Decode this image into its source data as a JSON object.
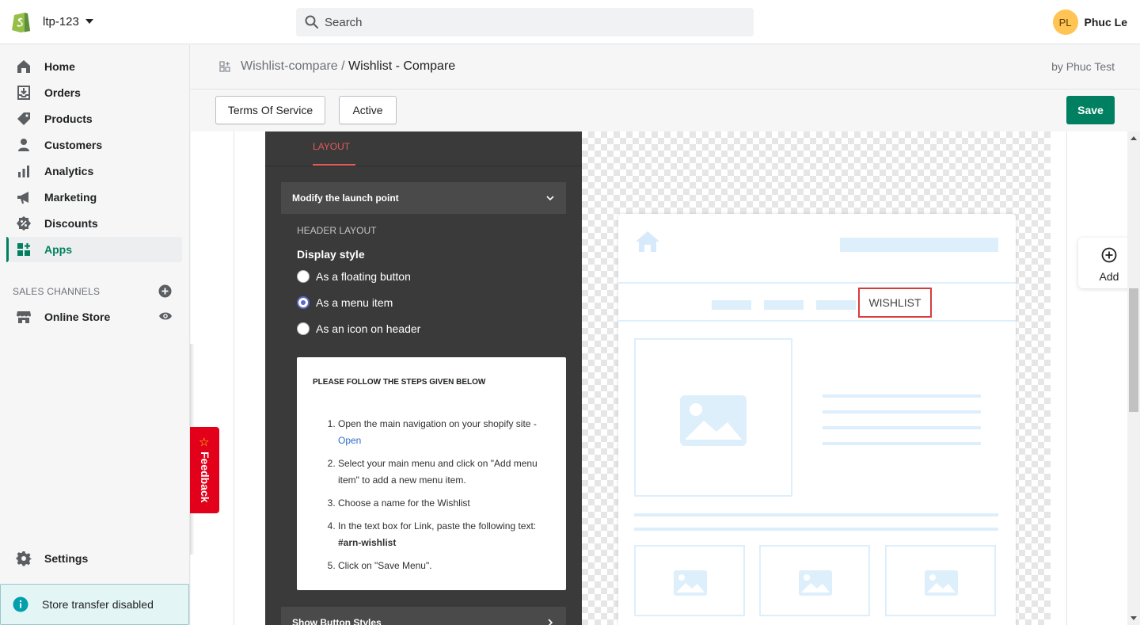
{
  "topbar": {
    "store_name": "ltp-123",
    "search_placeholder": "Search",
    "user_initials": "PL",
    "user_name": "Phuc Le"
  },
  "sidebar": {
    "items": [
      {
        "label": "Home",
        "icon": "home-icon"
      },
      {
        "label": "Orders",
        "icon": "orders-icon"
      },
      {
        "label": "Products",
        "icon": "tag-icon"
      },
      {
        "label": "Customers",
        "icon": "person-icon"
      },
      {
        "label": "Analytics",
        "icon": "bar-chart-icon"
      },
      {
        "label": "Marketing",
        "icon": "megaphone-icon"
      },
      {
        "label": "Discounts",
        "icon": "discount-icon"
      },
      {
        "label": "Apps",
        "icon": "apps-icon"
      }
    ],
    "active_item": "Apps",
    "sales_channels_heading": "SALES CHANNELS",
    "online_store_label": "Online Store",
    "settings_label": "Settings",
    "store_transfer": "Store transfer disabled"
  },
  "page": {
    "breadcrumb_parent": "Wishlist-compare",
    "breadcrumb_sep": "/",
    "breadcrumb_current": "Wishlist - Compare",
    "byline": "by Phuc Test",
    "tos_button": "Terms Of Service",
    "active_button": "Active",
    "save_button": "Save"
  },
  "editor": {
    "tab_layout": "LAYOUT",
    "accordion_launch": "Modify the launch point",
    "header_layout": "HEADER LAYOUT",
    "display_style": "Display style",
    "options": [
      {
        "label": "As a floating button",
        "selected": false
      },
      {
        "label": "As a menu item",
        "selected": true
      },
      {
        "label": "As an icon on header",
        "selected": false
      }
    ],
    "steps_heading": "PLEASE FOLLOW THE STEPS GIVEN BELOW",
    "steps": {
      "s1": "Open the main navigation on your shopify site -",
      "s1_link": "Open",
      "s2": "Select your main menu and click on \"Add menu item\" to add a new menu item.",
      "s3": "Choose a name for the Wishlist",
      "s4": "In the text box for Link, paste the following text:",
      "s4_code": "#arn-wishlist",
      "s5": "Click on \"Save Menu\"."
    },
    "accordion_button_styles": "Show Button Styles"
  },
  "preview": {
    "wishlist_label": "WISHLIST"
  },
  "add_widget": {
    "label": "Add"
  },
  "feedback": {
    "label": "Feedback"
  },
  "colors": {
    "accent_green": "#008060",
    "highlight_red": "#d63c3c",
    "feedback_red": "#e3001b",
    "dark_panel": "#3a3a3a"
  }
}
